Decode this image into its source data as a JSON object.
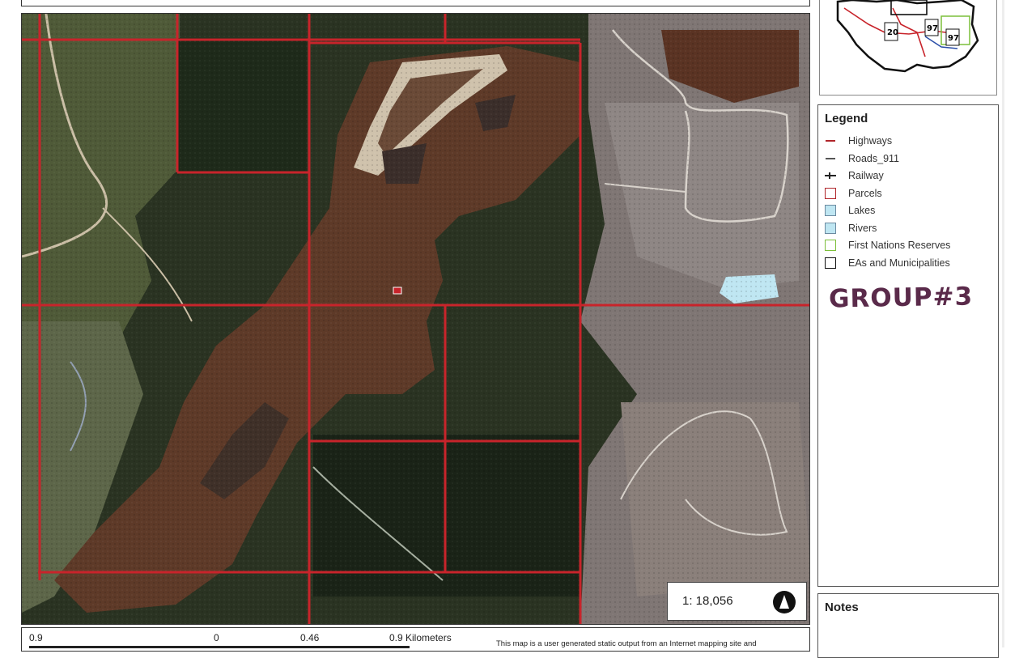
{
  "legend": {
    "title": "Legend",
    "items": [
      {
        "label": "Highways",
        "symbol": "line",
        "color": "#b0252a"
      },
      {
        "label": "Roads_911",
        "symbol": "line",
        "color": "#555555"
      },
      {
        "label": "Railway",
        "symbol": "rail",
        "color": "#222222"
      },
      {
        "label": "Parcels",
        "symbol": "box",
        "color": "#b0252a",
        "fill": "#ffffff"
      },
      {
        "label": "Lakes",
        "symbol": "box",
        "color": "#6b8aa0",
        "fill": "#bfe6f2"
      },
      {
        "label": "Rivers",
        "symbol": "box",
        "color": "#6b8aa0",
        "fill": "#bfe6f2"
      },
      {
        "label": "First Nations Reserves",
        "symbol": "box",
        "color": "#7cbf3a",
        "fill": "#ffffff"
      },
      {
        "label": "EAs and Municipalities",
        "symbol": "box",
        "color": "#111111",
        "fill": "#ffffff"
      }
    ]
  },
  "annotation": "GROUP#3",
  "notes": {
    "title": "Notes"
  },
  "scale": {
    "ratio": "1: 18,056"
  },
  "scalebar": {
    "labels": [
      "0.9",
      "0",
      "0.46",
      "0.9 Kilometers"
    ]
  },
  "disclaimer": "This map is a user generated static output from an Internet mapping site and",
  "inset_map": {
    "highway_shields": [
      "20",
      "97",
      "97"
    ]
  },
  "colors": {
    "parcel_line": "#c8242b",
    "lake": "#bfe6f2",
    "clearing_brown": "#5e3a28",
    "forest": "#1f2a1c",
    "cutblock_grey": "#8f8583"
  }
}
